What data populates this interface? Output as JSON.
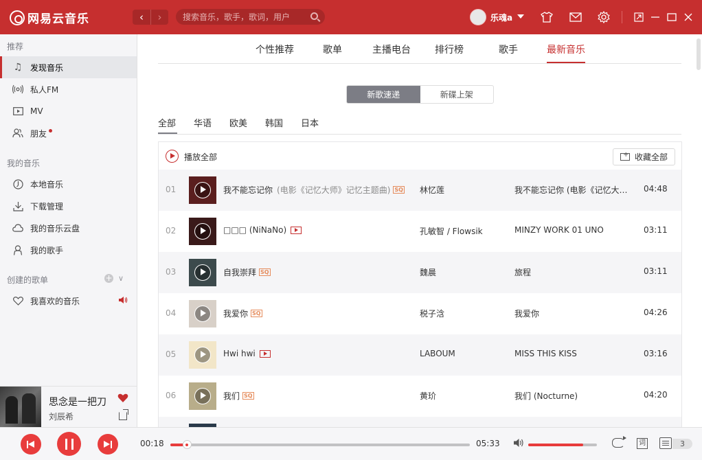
{
  "app": {
    "logo_text": "网易云音乐",
    "search_placeholder": "搜索音乐，歌手，歌词，用户",
    "username": "乐魂a"
  },
  "sidebar": {
    "section_recommend": "推荐",
    "items_recommend": [
      {
        "label": "发现音乐",
        "icon": "music-note-icon",
        "active": true
      },
      {
        "label": "私人FM",
        "icon": "radio-icon"
      },
      {
        "label": "MV",
        "icon": "video-icon"
      },
      {
        "label": "朋友",
        "icon": "friends-icon",
        "dot": true
      }
    ],
    "section_my_music": "我的音乐",
    "items_my_music": [
      {
        "label": "本地音乐",
        "icon": "local-music-icon"
      },
      {
        "label": "下载管理",
        "icon": "download-icon"
      },
      {
        "label": "我的音乐云盘",
        "icon": "cloud-icon"
      },
      {
        "label": "我的歌手",
        "icon": "singer-icon"
      }
    ],
    "section_created": "创建的歌单",
    "items_created": [
      {
        "label": "我喜欢的音乐",
        "icon": "heart-outline-icon",
        "playing": true
      }
    ]
  },
  "now_playing": {
    "title": "思念是一把刀",
    "artist": "刘辰希"
  },
  "tabs": [
    {
      "label": "个性推荐"
    },
    {
      "label": "歌单"
    },
    {
      "label": "主播电台"
    },
    {
      "label": "排行榜"
    },
    {
      "label": "歌手"
    },
    {
      "label": "最新音乐",
      "active": true
    }
  ],
  "segment": {
    "left": "新歌速递",
    "right": "新碟上架"
  },
  "filters": [
    {
      "label": "全部",
      "active": true
    },
    {
      "label": "华语"
    },
    {
      "label": "欧美"
    },
    {
      "label": "韩国"
    },
    {
      "label": "日本"
    }
  ],
  "list": {
    "play_all": "播放全部",
    "collect_all": "收藏全部",
    "rows": [
      {
        "no": "01",
        "title": "我不能忘记你",
        "alias": "(电影《记忆大师》记忆主题曲)",
        "badge": "sq",
        "artist": "林忆莲",
        "album": "我不能忘记你 (电影《记忆大师》记忆主题曲)",
        "duration": "04:48",
        "cover": "#5a1e1e"
      },
      {
        "no": "02",
        "title": "□□□  (NiNaNo)",
        "alias": "",
        "badge": "mv",
        "artist": "孔敏智 / Flowsik",
        "album": "MINZY WORK 01 UNO",
        "duration": "03:11",
        "cover": "#3a1a1a"
      },
      {
        "no": "03",
        "title": "自我崇拜",
        "alias": "",
        "badge": "sq",
        "artist": "魏晨",
        "album": "旅程",
        "duration": "03:11",
        "cover": "#3c4a4c"
      },
      {
        "no": "04",
        "title": "我爱你",
        "alias": "",
        "badge": "sq",
        "artist": "税子浛",
        "album": "我爱你",
        "duration": "04:26",
        "cover": "#d8d0c8"
      },
      {
        "no": "05",
        "title": "Hwi hwi",
        "alias": "",
        "badge": "mv",
        "artist": "LABOUM",
        "album": "MISS THIS KISS",
        "duration": "03:16",
        "cover": "#f2e6c8"
      },
      {
        "no": "06",
        "title": "我们",
        "alias": "",
        "badge": "sq",
        "artist": "黄玠",
        "album": "我们 (Nocturne)",
        "duration": "04:20",
        "cover": "#b8ad8a"
      }
    ]
  },
  "player": {
    "current_time": "00:18",
    "total_time": "05:33",
    "progress": 0.055,
    "volume": 0.8,
    "queue_count": "3",
    "lyric_label": "词"
  },
  "colors": {
    "brand": "#c62f2f",
    "accent": "#e83c3c"
  }
}
